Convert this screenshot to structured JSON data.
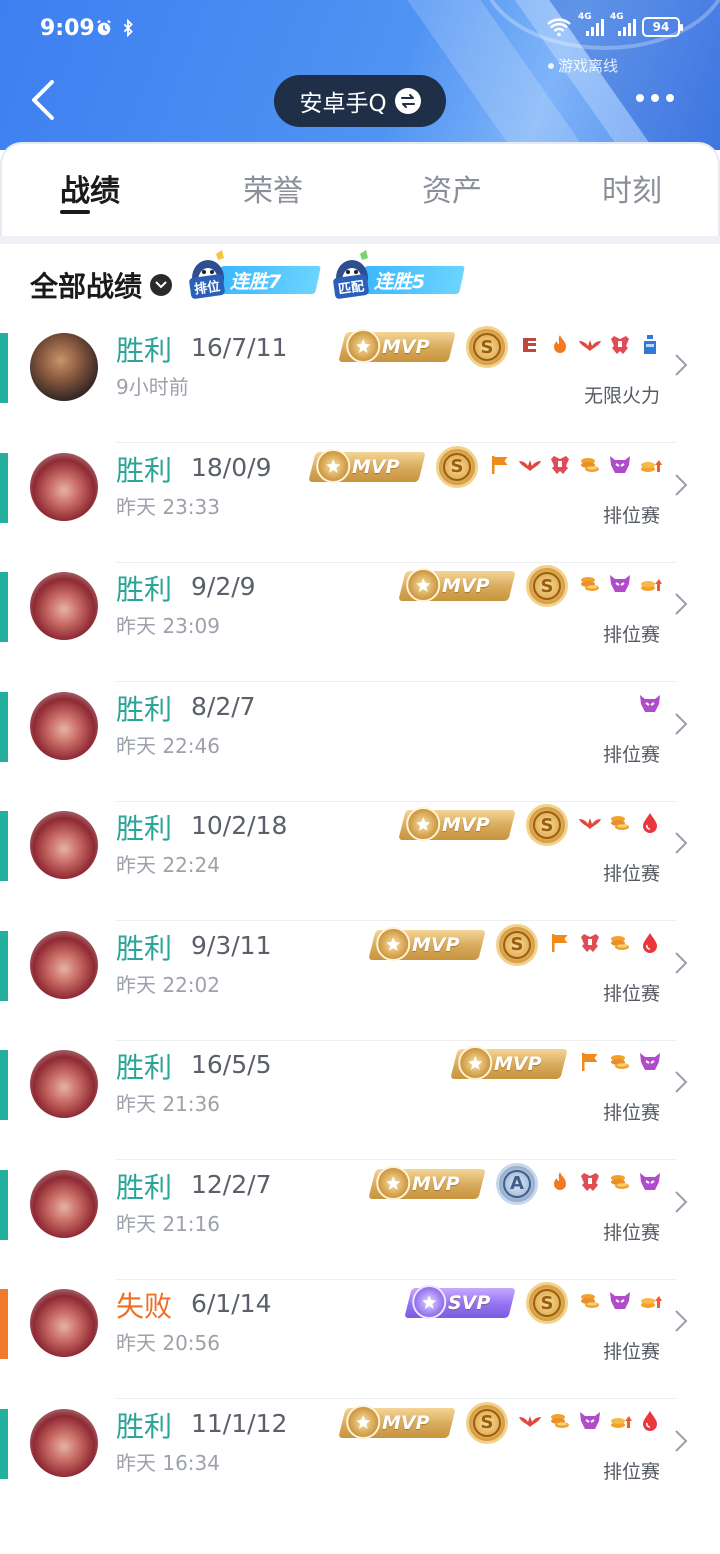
{
  "status_bar": {
    "time": "9:09",
    "icons": [
      "alarm-icon",
      "bluetooth-icon"
    ],
    "right_icons": [
      "wifi-icon",
      "signal-4g-icon",
      "signal-4g-icon"
    ],
    "signal_label_1": "4G",
    "signal_label_2": "4G",
    "battery": "94"
  },
  "header": {
    "offline_label": "游戏离线",
    "account_name": "安卓手Q"
  },
  "tabs": [
    {
      "label": "战绩",
      "active": true
    },
    {
      "label": "荣誉",
      "active": false
    },
    {
      "label": "资产",
      "active": false
    },
    {
      "label": "时刻",
      "active": false
    }
  ],
  "section": {
    "title": "全部战绩",
    "streaks": [
      {
        "tag": "排位",
        "text": "连胜7"
      },
      {
        "tag": "匹配",
        "text": "连胜5"
      }
    ]
  },
  "matches": [
    {
      "result": "胜利",
      "win": true,
      "kda": "16/7/11",
      "time": "9小时前",
      "mode": "无限火力",
      "hero": "hero-a",
      "mvp": "MVP",
      "grade": "S",
      "icons": [
        "triple-kill-icon",
        "fire-icon",
        "wings-icon",
        "tower-icon",
        "bottle-icon"
      ]
    },
    {
      "result": "胜利",
      "win": true,
      "kda": "18/0/9",
      "time": "昨天 23:33",
      "mode": "排位赛",
      "hero": "hero-b",
      "mvp": "MVP",
      "grade": "S",
      "icons": [
        "flag-icon",
        "wings-icon",
        "tower-icon",
        "coins-icon",
        "demon-icon",
        "gold-up-icon"
      ]
    },
    {
      "result": "胜利",
      "win": true,
      "kda": "9/2/9",
      "time": "昨天 23:09",
      "mode": "排位赛",
      "hero": "hero-b",
      "mvp": "MVP",
      "grade": "S",
      "icons": [
        "coins-icon",
        "demon-icon",
        "gold-up-icon"
      ]
    },
    {
      "result": "胜利",
      "win": true,
      "kda": "8/2/7",
      "time": "昨天 22:46",
      "mode": "排位赛",
      "hero": "hero-b",
      "mvp": "",
      "grade": "",
      "icons": [
        "demon-icon"
      ]
    },
    {
      "result": "胜利",
      "win": true,
      "kda": "10/2/18",
      "time": "昨天 22:24",
      "mode": "排位赛",
      "hero": "hero-b",
      "mvp": "MVP",
      "grade": "S",
      "icons": [
        "wings-icon",
        "coins-icon",
        "blood-icon"
      ]
    },
    {
      "result": "胜利",
      "win": true,
      "kda": "9/3/11",
      "time": "昨天 22:02",
      "mode": "排位赛",
      "hero": "hero-b",
      "mvp": "MVP",
      "grade": "S",
      "icons": [
        "flag-icon",
        "tower-icon",
        "coins-icon",
        "blood-icon"
      ]
    },
    {
      "result": "胜利",
      "win": true,
      "kda": "16/5/5",
      "time": "昨天 21:36",
      "mode": "排位赛",
      "hero": "hero-b",
      "mvp": "MVP",
      "grade": "",
      "icons": [
        "flag-icon",
        "coins-icon",
        "demon-icon"
      ]
    },
    {
      "result": "胜利",
      "win": true,
      "kda": "12/2/7",
      "time": "昨天 21:16",
      "mode": "排位赛",
      "hero": "hero-b",
      "mvp": "MVP",
      "grade": "A",
      "icons": [
        "fire-icon",
        "tower-icon",
        "coins-icon",
        "demon-icon"
      ]
    },
    {
      "result": "失败",
      "win": false,
      "kda": "6/1/14",
      "time": "昨天 20:56",
      "mode": "排位赛",
      "hero": "hero-b",
      "mvp": "SVP",
      "grade": "S",
      "icons": [
        "coins-icon",
        "demon-icon",
        "gold-up-icon"
      ]
    },
    {
      "result": "胜利",
      "win": true,
      "kda": "11/1/12",
      "time": "昨天 16:34",
      "mode": "排位赛",
      "hero": "hero-b",
      "mvp": "MVP",
      "grade": "S",
      "icons": [
        "wings-icon",
        "coins-icon",
        "demon-icon",
        "gold-up-icon",
        "blood-icon"
      ]
    }
  ],
  "colors": {
    "win": "#24b09e",
    "loss": "#f07b2d",
    "header_blue": "#4f93f3"
  }
}
